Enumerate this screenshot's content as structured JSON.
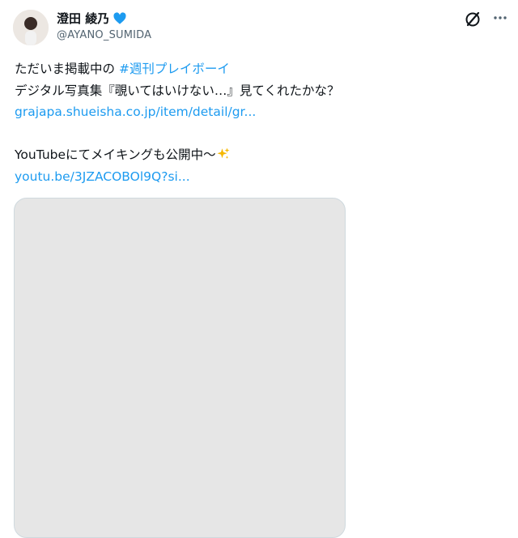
{
  "author": {
    "display_name": "澄田 綾乃",
    "handle": "@AYANO_SUMIDA",
    "verified_badge_color": "#1d9bf0"
  },
  "post": {
    "line1_prefix": "ただいま掲載中の ",
    "line1_hashtag": "#週刊プレイボーイ",
    "line2": "デジタル写真集『覗いてはいけない…』見てくれたかな？",
    "link1": "grajapa.shueisha.co.jp/item/detail/gr...",
    "line4": "YouTubeにてメイキングも公開中〜",
    "link2": "youtu.be/3JZACOBOl9Q?si..."
  },
  "icons": {
    "top_right": "grok-icon",
    "more": "more-options-icon",
    "badge": "verified-heart-icon",
    "emoji": "sparkles-icon"
  },
  "colors": {
    "link": "#1d9bf0",
    "secondary_text": "#536471"
  }
}
